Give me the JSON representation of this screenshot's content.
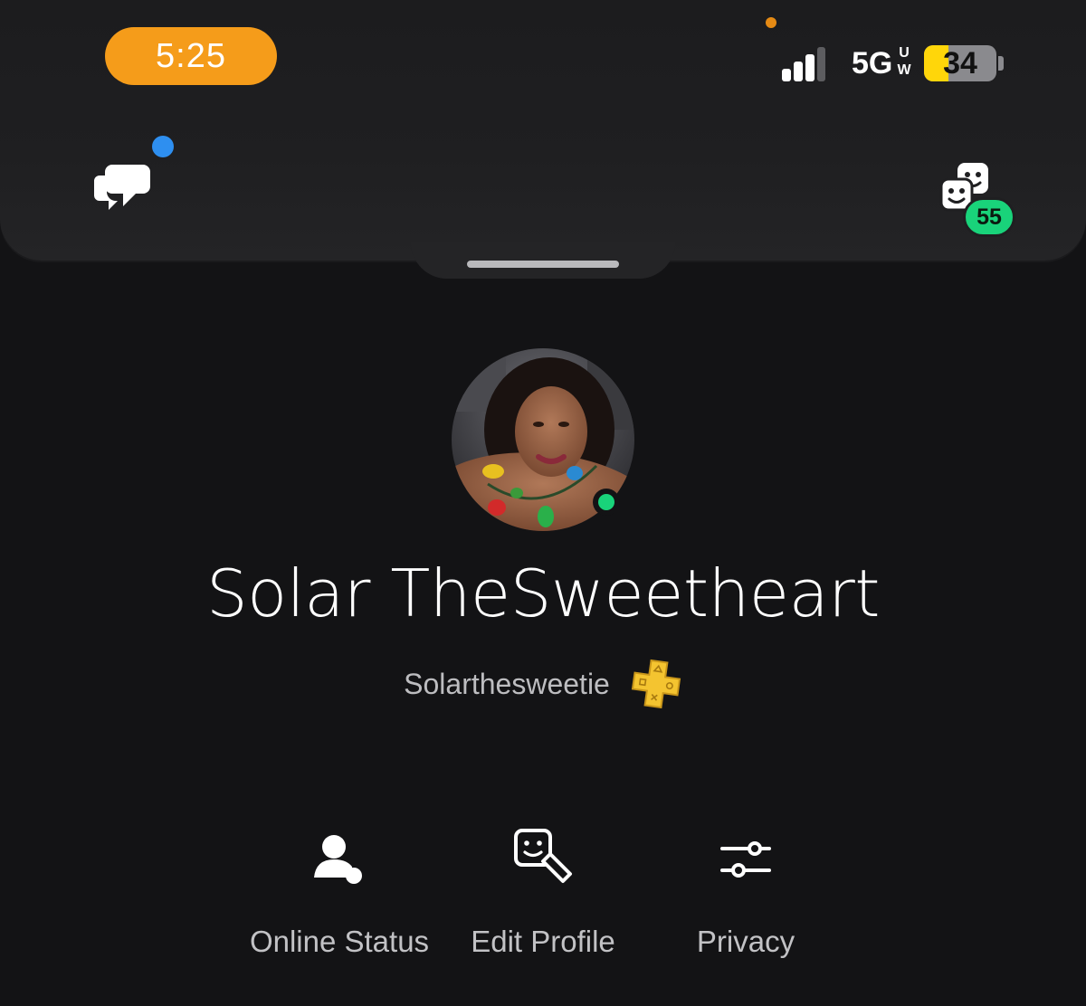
{
  "status_bar": {
    "time": "5:25",
    "network": "5G",
    "network_sup_top": "U",
    "network_sup_bottom": "W",
    "battery_percent": "34",
    "battery_level": 0.34,
    "signal_bars": 4,
    "signal_active": 3
  },
  "header": {
    "left_icon": "chat-bubbles-icon",
    "right_icon": "friends-icon",
    "friends_count": "55"
  },
  "profile": {
    "display_name": "Solar TheSweetheart",
    "online_id": "Solarthesweetie",
    "plus_icon": "playstation-plus-icon",
    "status": "online"
  },
  "actions": [
    {
      "label": "Online Status",
      "icon": "online-status-icon"
    },
    {
      "label": "Edit Profile",
      "icon": "edit-profile-icon"
    },
    {
      "label": "Privacy",
      "icon": "privacy-sliders-icon"
    }
  ],
  "colors": {
    "background": "#131315",
    "time_pill": "#f59c1a",
    "online_green": "#19d37a",
    "notification_blue": "#2e8ff0",
    "battery_yellow": "#ffd60a",
    "plus_gold": "#f4c430"
  }
}
